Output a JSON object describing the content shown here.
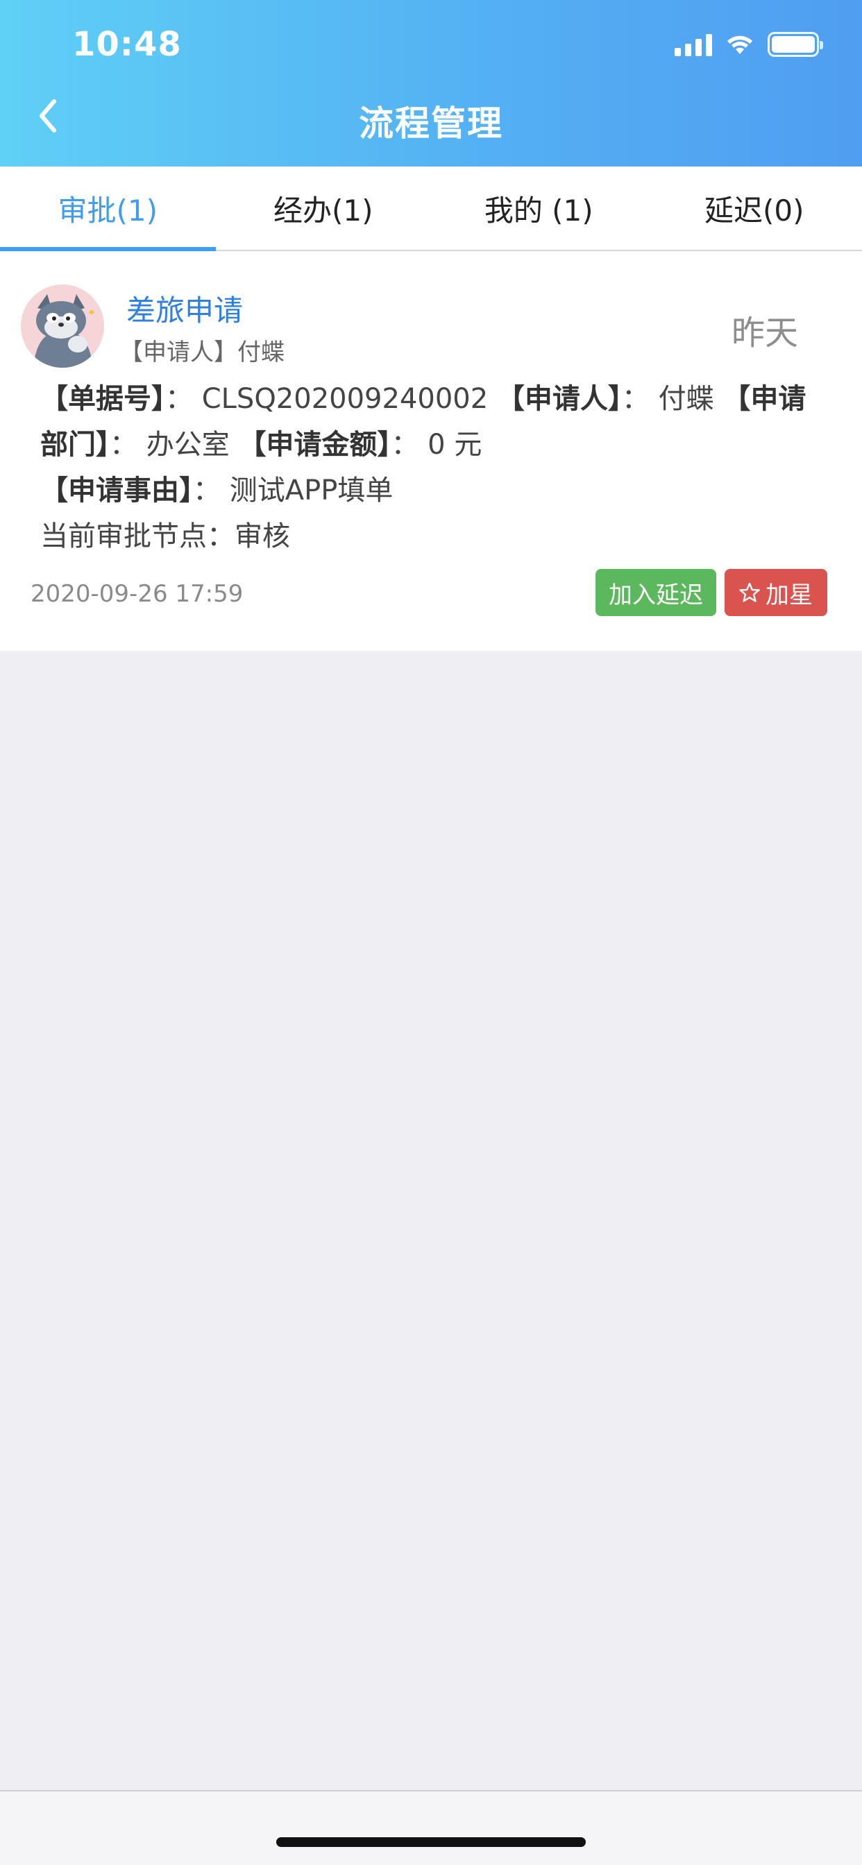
{
  "status_bar": {
    "time": "10:48",
    "icons": [
      "signal-icon",
      "wifi-icon",
      "battery-icon"
    ]
  },
  "nav": {
    "title": "流程管理",
    "back_icon": "chevron-left-icon"
  },
  "tabs": [
    {
      "label": "审批(1)",
      "active": true
    },
    {
      "label": "经办(1)",
      "active": false
    },
    {
      "label": "我的 (1)",
      "active": false
    },
    {
      "label": "延迟(0)",
      "active": false
    }
  ],
  "card": {
    "title": "差旅申请",
    "applicant": "【申请人】付蝶",
    "relative_time": "昨天",
    "doc_no_label": "【单据号】",
    "doc_no_sep": "：",
    "doc_no": "CLSQ202009240002",
    "applicant_label": "【申请人】",
    "applicant_sep": "：",
    "applicant_name": "付蝶",
    "dept_label": "【申请部门】",
    "dept_sep": "：",
    "dept": "办公室",
    "amount_label": "【申请金额】",
    "amount_sep": "：",
    "amount": "0 元",
    "reason_label": "【申请事由】",
    "reason_sep": "：",
    "reason": "测试APP填单",
    "node_text": "当前审批节点：审核",
    "date": "2020-09-26 17:59",
    "delay_button": "加入延迟",
    "star_button": "加星",
    "star_icon": "star-outline-icon"
  },
  "colors": {
    "header_start": "#5fd0f6",
    "header_end": "#4f9ef1",
    "accent": "#3f9df0",
    "title_blue": "#2e7fe0",
    "delay_green": "#5cb85c",
    "star_red": "#d9534f"
  }
}
